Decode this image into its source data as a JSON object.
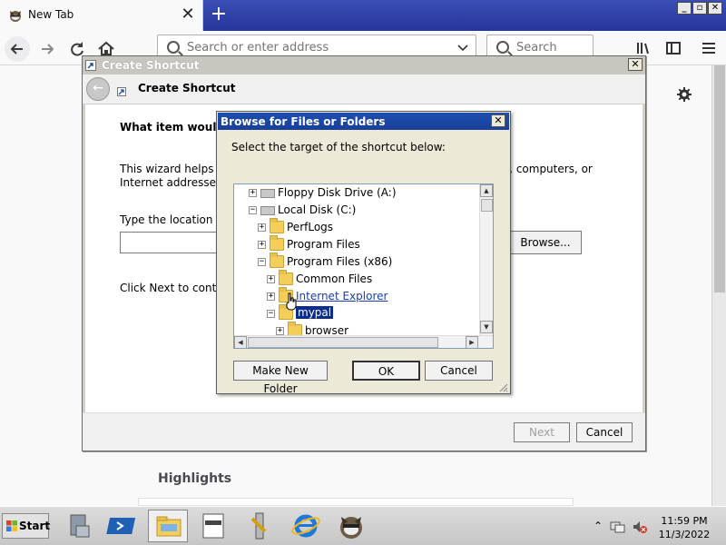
{
  "browser": {
    "tab_title": "New Tab",
    "tab_close": "✕",
    "new_tab": "+",
    "url_placeholder": "Search or enter address",
    "search_placeholder": "Search",
    "window_min": "_",
    "window_max": "▫",
    "window_close": "✕"
  },
  "page": {
    "highlights": "Highlights"
  },
  "wizard": {
    "title": "Create Shortcut",
    "close": "✕",
    "heading": "Create Shortcut",
    "question": "What item would yo",
    "para1": "This wizard helps yo                                                                          rs, computers, or Internet addresses.",
    "para1_left": "This wizard helps yo",
    "para1_right": "rs, computers, or",
    "para1_line2": "Internet addresses.",
    "location_label": "Type the location of",
    "browse_button": "Browse...",
    "next_text": "Click Next to contin",
    "next_button": "Next",
    "cancel_button": "Cancel"
  },
  "browse_dialog": {
    "title": "Browse for Files or Folders",
    "close": "✕",
    "instruction": "Select the target of the shortcut below:",
    "tree": [
      {
        "label": "Floppy Disk Drive (A:)",
        "level": 0,
        "expander": "+",
        "icon": "floppy-drive-icon",
        "style": ""
      },
      {
        "label": "Local Disk (C:)",
        "level": 0,
        "expander": "−",
        "icon": "local-disk-icon",
        "style": ""
      },
      {
        "label": "PerfLogs",
        "level": 1,
        "expander": "+",
        "icon": "folder-icon",
        "style": ""
      },
      {
        "label": "Program Files",
        "level": 1,
        "expander": "+",
        "icon": "folder-icon",
        "style": ""
      },
      {
        "label": "Program Files (x86)",
        "level": 1,
        "expander": "−",
        "icon": "folder-icon",
        "style": ""
      },
      {
        "label": "Common Files",
        "level": 2,
        "expander": "+",
        "icon": "folder-icon",
        "style": ""
      },
      {
        "label": "Internet Explorer",
        "level": 2,
        "expander": "+",
        "icon": "folder-icon",
        "style": "link"
      },
      {
        "label": "mypal",
        "level": 2,
        "expander": "−",
        "icon": "folder-icon",
        "style": "sel"
      },
      {
        "label": "browser",
        "level": 3,
        "expander": "+",
        "icon": "folder-icon",
        "style": ""
      }
    ],
    "make_new_folder": "Make New Folder",
    "ok": "OK",
    "cancel": "Cancel"
  },
  "taskbar": {
    "start": "Start",
    "apps": [
      "server-manager-icon",
      "powershell-icon",
      "file-explorer-icon",
      "notepad-document-icon",
      "tools-icon",
      "internet-explorer-icon",
      "mypal-browser-icon"
    ],
    "active_app": "file-explorer-icon",
    "time": "11:59 PM",
    "date": "11/3/2022",
    "show_hidden": "⌃"
  }
}
